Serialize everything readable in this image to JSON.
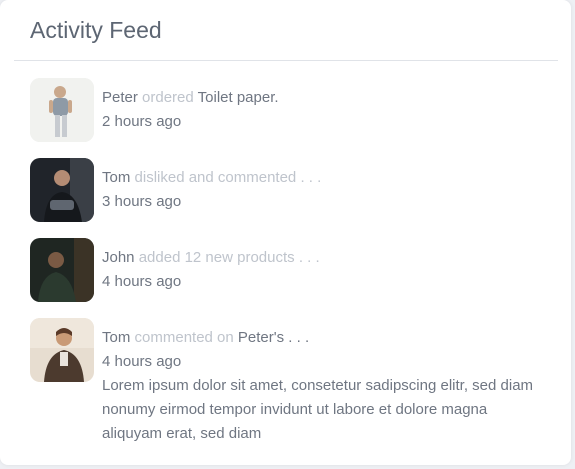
{
  "card": {
    "title": "Activity Feed"
  },
  "feed": [
    {
      "avatar": "person-avatar",
      "name": "Peter",
      "action": "ordered",
      "target": "Toilet paper.",
      "time": "2 hours ago"
    },
    {
      "avatar": "person-avatar",
      "name": "Tom",
      "action": "disliked and commented . . .",
      "target": "",
      "time": "3 hours ago"
    },
    {
      "avatar": "person-avatar",
      "name": "John",
      "action": "added 12 new products . . .",
      "target": "",
      "time": "4 hours ago"
    },
    {
      "avatar": "person-avatar",
      "name": "Tom",
      "action": "commented on",
      "target": "Peter's . . .",
      "time": "4 hours ago",
      "message": "Lorem ipsum dolor sit amet, consetetur sadipscing elitr, sed diam nonumy eirmod tempor invidunt ut labore et dolore magna aliquyam erat, sed diam"
    }
  ],
  "colors": {
    "muted": "#bfc4cc",
    "text": "#6f7682",
    "title": "#5d6673"
  }
}
